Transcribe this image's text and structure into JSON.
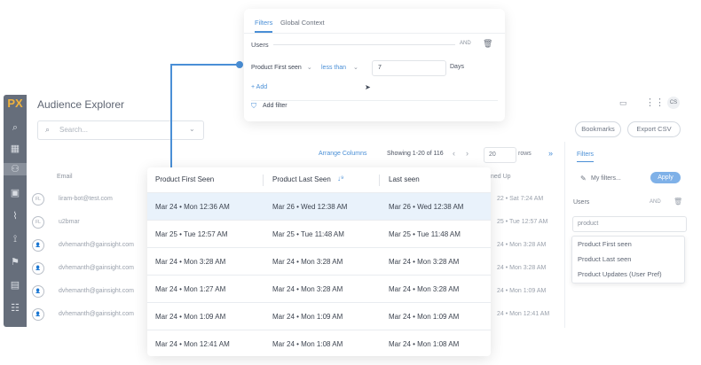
{
  "app": {
    "logo": "PX",
    "title": "Audience Explorer",
    "search_placeholder": "Search...",
    "arrange_columns": "Arrange Columns",
    "showing": "Showing 1-20 of 116",
    "page_size": "20",
    "rows_label": "rows",
    "bookmarks": "Bookmarks",
    "export": "Export CSV",
    "user_initials": "CS",
    "email_header": "Email",
    "signed_up_header": "ned Up",
    "rows": [
      {
        "avatar": "FL",
        "email": "liram-bot@test.com",
        "signed": "22 • Sat  7:24 AM"
      },
      {
        "avatar": "FL",
        "email": "u2bmar",
        "signed": "25 • Tue  12:57 AM"
      },
      {
        "avatar": "",
        "email": "dvhemanth@gainsight.com",
        "signed": "24 • Mon  3:28 AM"
      },
      {
        "avatar": "",
        "email": "dvhemanth@gainsight.com",
        "signed": "24 • Mon  3:28 AM"
      },
      {
        "avatar": "",
        "email": "dvhemanth@gainsight.com",
        "signed": "24 • Mon  1:09 AM"
      },
      {
        "avatar": "",
        "email": "dvhemanth@gainsight.com",
        "signed": "24 • Mon  12:41 AM"
      }
    ]
  },
  "right_panel": {
    "tab": "Filters",
    "my_filters": "My filters...",
    "apply": "Apply",
    "users": "Users",
    "and": "AND",
    "search_value": "product",
    "options": [
      "Product First seen",
      "Product Last seen",
      "Product Updates (User Pref)"
    ]
  },
  "filter_card": {
    "tabs": [
      "Filters",
      "Global Context"
    ],
    "users": "Users",
    "and": "AND",
    "field": "Product First seen",
    "operator": "less than",
    "value": "7",
    "unit": "Days",
    "add": "+ Add",
    "add_filter": "Add filter"
  },
  "table": {
    "headers": [
      "Product First Seen",
      "Product Last Seen",
      "Last seen"
    ],
    "rows": [
      [
        "Mar 24 • Mon   12:36 AM",
        "Mar 26 • Wed   12:38 AM",
        "Mar 26 • Wed   12:38 AM"
      ],
      [
        "Mar 25 • Tue   12:57 AM",
        "Mar 25 • Tue   11:48 AM",
        "Mar 25 • Tue   11:48 AM"
      ],
      [
        "Mar 24 • Mon   3:28 AM",
        "Mar 24 • Mon   3:28 AM",
        "Mar 24 • Mon   3:28 AM"
      ],
      [
        "Mar 24 • Mon   1:27 AM",
        "Mar 24 • Mon   3:28 AM",
        "Mar 24 • Mon   3:28 AM"
      ],
      [
        "Mar 24 • Mon   1:09 AM",
        "Mar 24 • Mon   1:09 AM",
        "Mar 24 • Mon   1:09 AM"
      ],
      [
        "Mar 24 • Mon   12:41 AM",
        "Mar 24 • Mon   1:08 AM",
        "Mar 24 • Mon   1:08 AM"
      ]
    ]
  },
  "colors": {
    "accent": "#4a8fd6",
    "sidebar": "#666e7b",
    "highlight_row": "#e9f2fb"
  }
}
